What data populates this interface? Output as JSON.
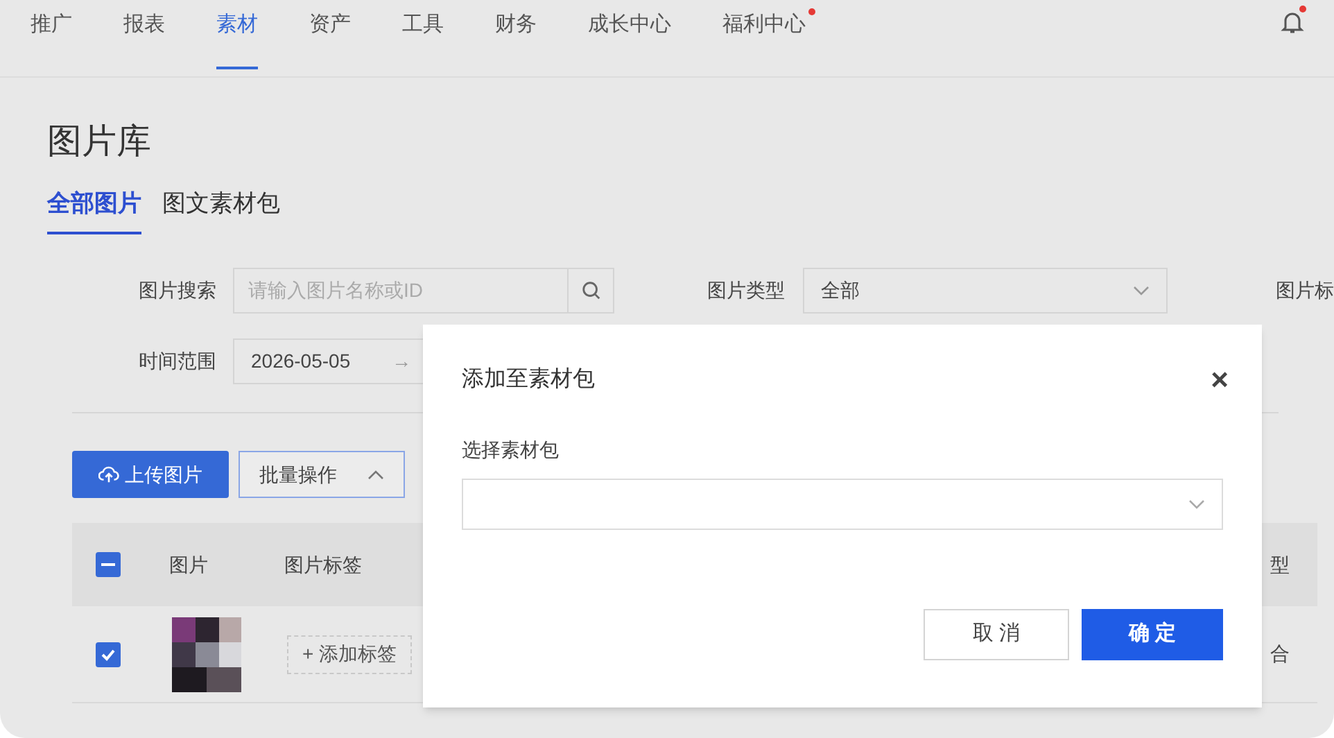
{
  "nav": {
    "items": [
      {
        "label": "推广",
        "selected": false,
        "dot": false
      },
      {
        "label": "报表",
        "selected": false,
        "dot": false
      },
      {
        "label": "素材",
        "selected": true,
        "dot": false
      },
      {
        "label": "资产",
        "selected": false,
        "dot": false
      },
      {
        "label": "工具",
        "selected": false,
        "dot": false
      },
      {
        "label": "财务",
        "selected": false,
        "dot": false
      },
      {
        "label": "成长中心",
        "selected": false,
        "dot": false
      },
      {
        "label": "福利中心",
        "selected": false,
        "dot": true
      }
    ],
    "bell_dot": true
  },
  "page": {
    "title": "图片库",
    "tabs": [
      {
        "label": "全部图片",
        "selected": true
      },
      {
        "label": "图文素材包",
        "selected": false
      }
    ]
  },
  "filters": {
    "search": {
      "label": "图片搜索",
      "placeholder": "请输入图片名称或ID"
    },
    "type": {
      "label": "图片类型",
      "value": "全部"
    },
    "tag_label": "图片标",
    "time": {
      "label": "时间范围",
      "start": "2026-05-05",
      "arrow": "→"
    }
  },
  "actions": {
    "upload": "上传图片",
    "batch": {
      "label": "批量操作",
      "expanded": true
    }
  },
  "table": {
    "select_all": {
      "indeterminate": true
    },
    "columns": [
      "图片",
      "图片标签"
    ],
    "column_cut": "型",
    "rows": [
      {
        "checked": true,
        "add_tag": "+ 添加标签",
        "cell_cut": "合"
      }
    ]
  },
  "dialog": {
    "title": "添加至素材包",
    "close": "×",
    "field_label": "选择素材包",
    "cancel": "取 消",
    "confirm": "确 定"
  }
}
